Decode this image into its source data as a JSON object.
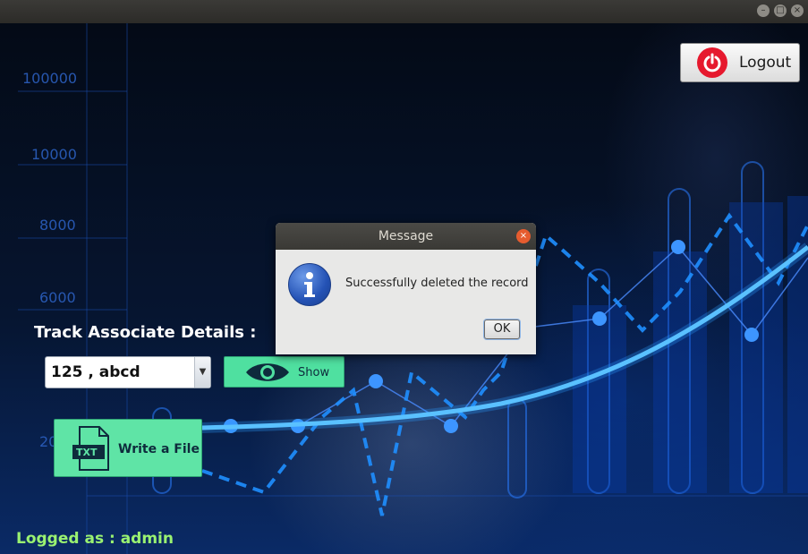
{
  "window": {
    "controls": [
      "minimize",
      "maximize",
      "close"
    ]
  },
  "background": {
    "y_ticks": [
      "100000",
      "10000",
      "8000",
      "6000",
      "20"
    ]
  },
  "header": {
    "logout_label": "Logout",
    "logout_icon": "power-icon",
    "logout_color": "#e6192e"
  },
  "main": {
    "section_title": "Track Associate Details :",
    "associate_select": {
      "value": "125 , abcd"
    },
    "show_button": {
      "label": "Show",
      "icon": "eye-icon"
    },
    "write_file_button": {
      "label": "Write a File",
      "icon_text": "TXT",
      "icon": "txt-file-icon"
    },
    "accent": "#4fe0a0"
  },
  "footer": {
    "logged_as_label": "Logged as  :  admin",
    "color": "#9af271"
  },
  "dialog": {
    "title": "Message",
    "message": "Successfully deleted the record",
    "ok_label": "OK",
    "icon": "info-icon"
  }
}
